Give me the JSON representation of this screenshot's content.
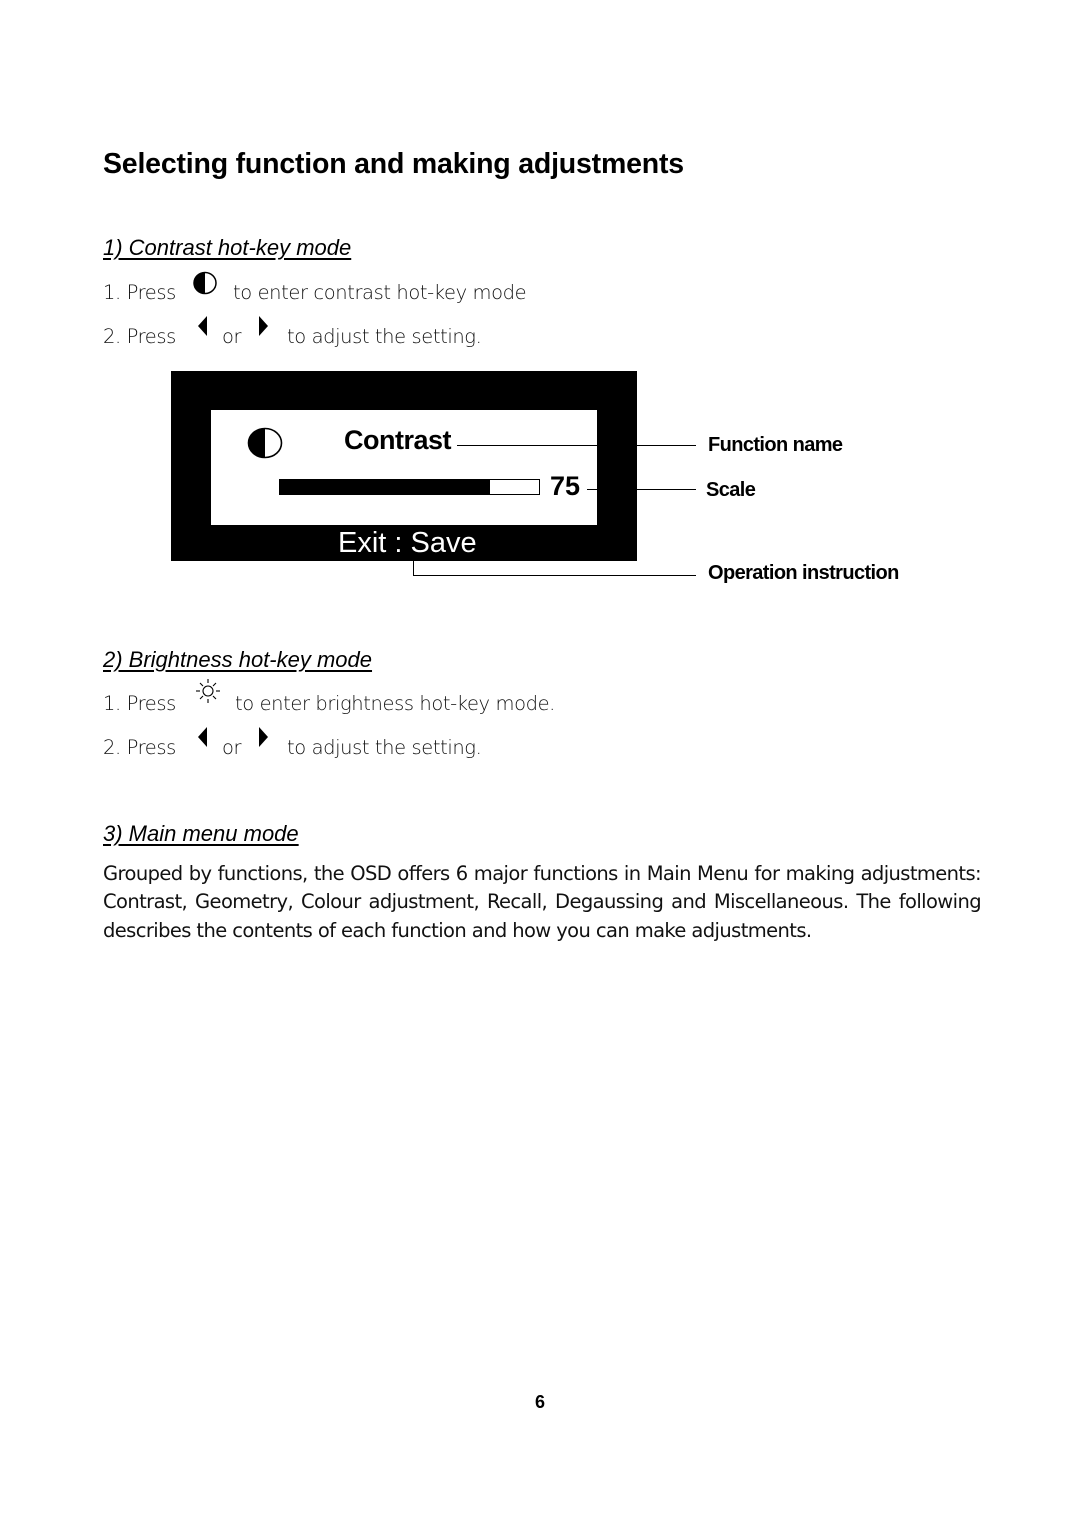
{
  "page": {
    "title": "Selecting function and making adjustments",
    "page_number": "6"
  },
  "sections": [
    {
      "heading": "1) Contrast hot-key mode",
      "steps": [
        {
          "prefix": "1. Press",
          "icon": "contrast-icon",
          "suffix": "to enter contrast hot-key mode"
        },
        {
          "prefix": "2. Press",
          "icon_left": "left-arrow-icon",
          "middle": "or",
          "icon_right": "right-arrow-icon",
          "suffix": "to adjust the setting."
        }
      ]
    },
    {
      "heading": "2) Brightness hot-key mode",
      "steps": [
        {
          "prefix": "1. Press",
          "icon": "brightness-icon",
          "suffix": "to enter brightness hot-key mode."
        },
        {
          "prefix": "2. Press",
          "icon_left": "left-arrow-icon",
          "middle": "or",
          "icon_right": "right-arrow-icon",
          "suffix": "to adjust the setting."
        }
      ]
    },
    {
      "heading": "3) Main menu mode",
      "paragraph": "Grouped by functions, the OSD offers 6 major functions in Main Menu for making adjustments: Contrast, Geometry, Colour adjustment, Recall, Degaussing and Miscellaneous.  The following describes the contents of each function and how you can make adjustments."
    }
  ],
  "osd_diagram": {
    "function_icon": "contrast-icon",
    "function_name": "Contrast",
    "scale_value": "75",
    "scale_fill_percent": 81,
    "operation_instruction": "Exit : Save",
    "callouts": {
      "function_name": "Function name",
      "scale": "Scale",
      "operation_instruction": "Operation instruction"
    }
  }
}
